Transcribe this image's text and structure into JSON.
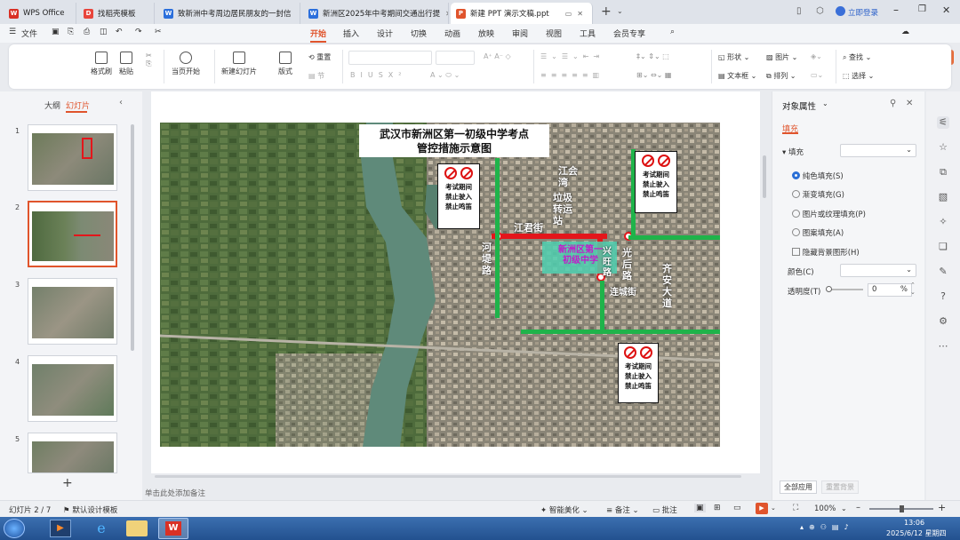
{
  "tabs": [
    {
      "label": "WPS Office",
      "icon": "wps-logo-icon",
      "color": "#d93025"
    },
    {
      "label": "找稻壳模板",
      "icon": "docer-icon",
      "color": "#e8453c"
    },
    {
      "label": "致新洲中考周边居民朋友的一封信",
      "icon": "word-doc-icon",
      "color": "#2b6fdc"
    },
    {
      "label": "新洲区2025年中考期间交通出行提",
      "icon": "word-doc-icon",
      "color": "#2b6fdc"
    },
    {
      "label": "新建 PPT 演示文稿.ppt",
      "icon": "ppt-doc-icon",
      "color": "#e0542c"
    }
  ],
  "titlebar": {
    "login": "立即登录"
  },
  "menu": {
    "file": "文件",
    "items": [
      "开始",
      "插入",
      "设计",
      "切换",
      "动画",
      "放映",
      "审阅",
      "视图",
      "工具",
      "会员专享"
    ],
    "active": "开始",
    "share": "分享"
  },
  "ribbon": {
    "format_painter": "格式刷",
    "paste": "粘贴",
    "from_current": "当页开始",
    "new_slide": "新建幻灯片",
    "layout": "版式",
    "reset": "重置",
    "section": "节",
    "shape": "形状",
    "picture": "图片",
    "find": "查找",
    "textbox": "文本框",
    "arrange": "排列",
    "select": "选择"
  },
  "leftpanel": {
    "outline_tab": "大纲",
    "slides_tab": "幻灯片",
    "slide_numbers": [
      "1",
      "2",
      "3",
      "4",
      "5"
    ]
  },
  "slide": {
    "title_line1": "武汉市新洲区第一初级中学考点",
    "title_line2": "管控措施示意图",
    "sign_text1": "考试期间",
    "sign_text2": "禁止驶入",
    "sign_text3": "禁止鸣笛",
    "school_label_line1": "新洲区第一",
    "school_label_line2": "初级中学",
    "streets": {
      "jiangjun": "江君街",
      "hedi": "河堤路",
      "jiangyu": "江会湾",
      "lajizhan": "垃圾转运站",
      "guanghou": "光后路",
      "qiya": "齐安大道",
      "lianchan": "连城街",
      "xinghu": "兴旺路"
    }
  },
  "notes_placeholder": "单击此处添加备注",
  "rightpanel": {
    "title": "对象属性",
    "tab_fill": "填充",
    "section_fill": "填充",
    "options": [
      "纯色填充(S)",
      "渐变填充(G)",
      "图片或纹理填充(P)",
      "图案填充(A)"
    ],
    "hide_bg": "隐藏背景图形(H)",
    "color_label": "颜色(C)",
    "transparency_label": "透明度(T)",
    "transparency_value": "0",
    "transparency_unit": "%",
    "apply_all": "全部应用",
    "reset_bg": "重置背景"
  },
  "status": {
    "slide_info": "幻灯片 2 / 7",
    "theme": "默认设计模板",
    "smart_beautify": "智能美化",
    "notes": "备注",
    "comments": "批注",
    "zoom": "100%"
  },
  "taskbar": {
    "time": "13:06",
    "date": "2025/6/12 星期四"
  },
  "colors": {
    "accent": "#e0542c",
    "road_red": "#e3161b",
    "road_green": "#1fb34a",
    "water": "#5f8a7a"
  }
}
